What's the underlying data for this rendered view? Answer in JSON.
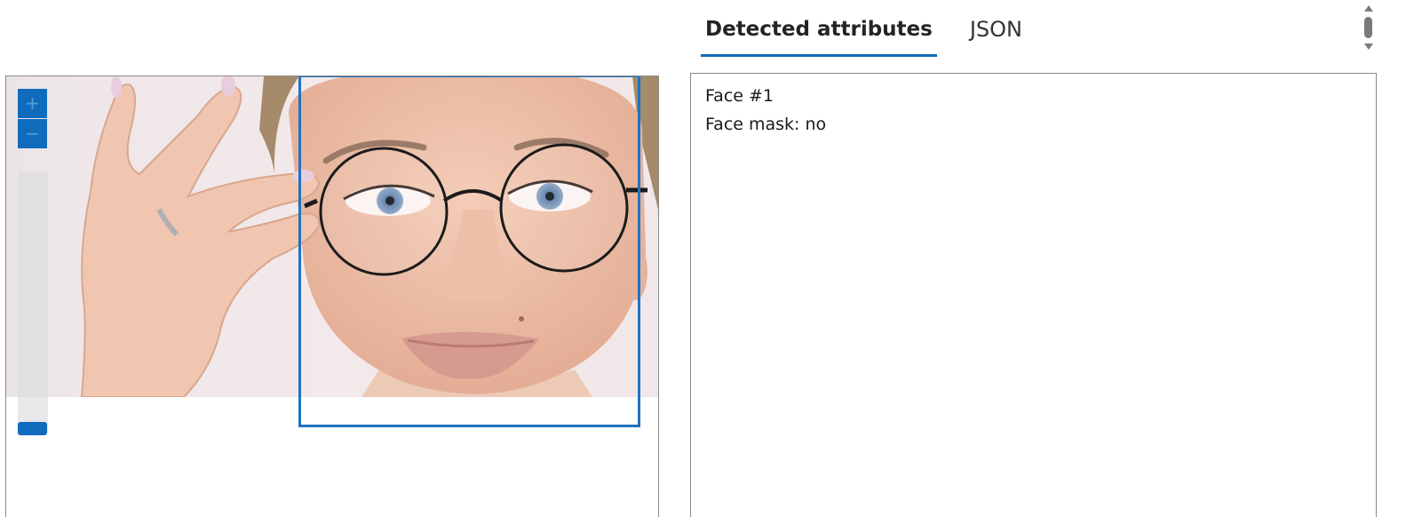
{
  "tabs": [
    {
      "label": "Detected attributes",
      "active": true
    },
    {
      "label": "JSON",
      "active": false
    }
  ],
  "viewer": {
    "zoom_in_label": "+",
    "zoom_out_label": "−",
    "zoom_level": 0,
    "accent_color": "#0f6cbd",
    "face_box_color": "#1f73c0"
  },
  "attributes": {
    "lines": [
      "Face #1",
      "Face mask: no"
    ]
  },
  "icons": [
    "zoom-in-icon",
    "zoom-out-icon",
    "scroll-up-icon",
    "scroll-down-icon"
  ]
}
